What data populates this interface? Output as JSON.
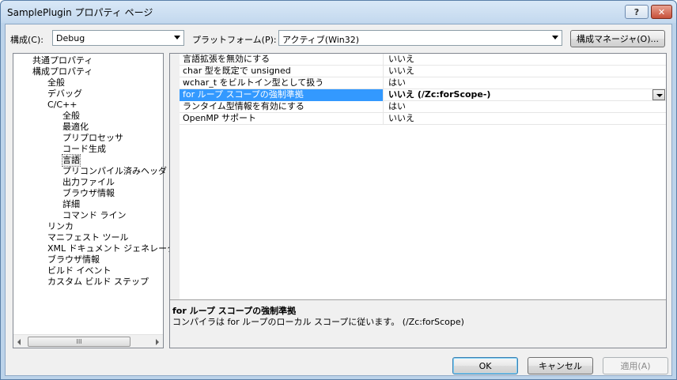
{
  "window": {
    "title": "SamplePlugin プロパティ ページ",
    "help_label": "?",
    "close_label": "✕"
  },
  "toolbar": {
    "config_label": "構成(C):",
    "config_value": "Debug",
    "platform_label": "プラットフォーム(P):",
    "platform_value": "アクティブ(Win32)",
    "config_manager_label": "構成マネージャ(O)..."
  },
  "tree": {
    "items": [
      {
        "label": "共通プロパティ",
        "level": 1
      },
      {
        "label": "構成プロパティ",
        "level": 1
      },
      {
        "label": "全般",
        "level": 2
      },
      {
        "label": "デバッグ",
        "level": 2
      },
      {
        "label": "C/C++",
        "level": 2
      },
      {
        "label": "全般",
        "level": 3
      },
      {
        "label": "最適化",
        "level": 3
      },
      {
        "label": "プリプロセッサ",
        "level": 3
      },
      {
        "label": "コード生成",
        "level": 3
      },
      {
        "label": "言語",
        "level": 3,
        "selected": true
      },
      {
        "label": "プリコンパイル済みヘッダ",
        "level": 3
      },
      {
        "label": "出力ファイル",
        "level": 3
      },
      {
        "label": "ブラウザ情報",
        "level": 3
      },
      {
        "label": "詳細",
        "level": 3
      },
      {
        "label": "コマンド ライン",
        "level": 3
      },
      {
        "label": "リンカ",
        "level": 2
      },
      {
        "label": "マニフェスト ツール",
        "level": 2
      },
      {
        "label": "XML ドキュメント ジェネレータ",
        "level": 2
      },
      {
        "label": "ブラウザ情報",
        "level": 2
      },
      {
        "label": "ビルド イベント",
        "level": 2
      },
      {
        "label": "カスタム ビルド ステップ",
        "level": 2
      }
    ],
    "scroll_thumb_label": "III"
  },
  "properties": {
    "rows": [
      {
        "name": "言語拡張を無効にする",
        "value": "いいえ"
      },
      {
        "name": "char 型を既定で unsigned",
        "value": "いいえ"
      },
      {
        "name": "wchar_t をビルトイン型として扱う",
        "value": "はい"
      },
      {
        "name": "for ループ スコープの強制準拠",
        "value": "いいえ (/Zc:forScope-)",
        "selected": true
      },
      {
        "name": "ランタイム型情報を有効にする",
        "value": "はい"
      },
      {
        "name": "OpenMP サポート",
        "value": "いいえ"
      }
    ],
    "description": {
      "title": "for ループ スコープの強制準拠",
      "text": "コンパイラは for ループのローカル スコープに従います。    (/Zc:forScope)"
    }
  },
  "footer": {
    "ok_label": "OK",
    "cancel_label": "キャンセル",
    "apply_label": "適用(A)"
  }
}
